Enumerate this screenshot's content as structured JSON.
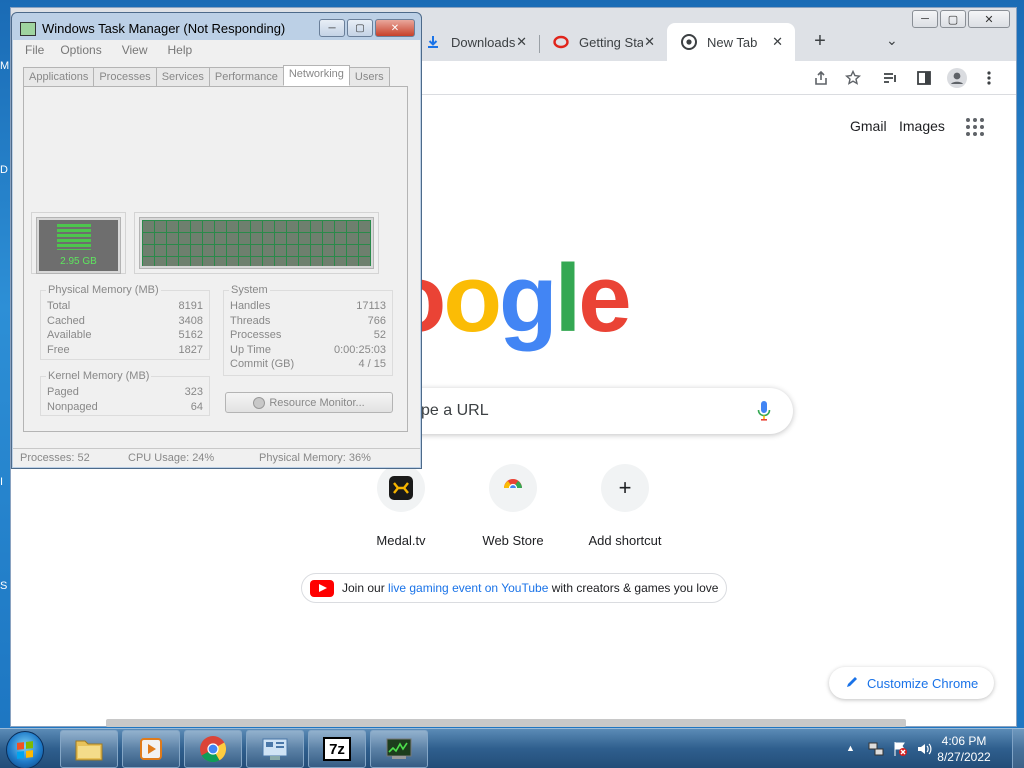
{
  "desktop": {
    "fragments": [
      "M",
      "D",
      "I",
      "S"
    ]
  },
  "chrome": {
    "window_controls": {
      "minimize": "─",
      "maximize": "▢",
      "close": "✕"
    },
    "tabs": [
      {
        "title": "Downloads",
        "icon": "download-icon"
      },
      {
        "title": "Getting Star",
        "icon": "opera-icon"
      },
      {
        "title": "New Tab",
        "icon": "chrome-icon",
        "active": true
      }
    ],
    "tab_close": "✕",
    "new_tab": "+",
    "tab_search": "⌄",
    "toolbar_icons": [
      "share-icon",
      "bookmark-star-icon",
      "media-controls-icon",
      "side-panel-icon",
      "profile-icon",
      "menu-icon"
    ],
    "ntp": {
      "gmail": "Gmail",
      "images": "Images",
      "logo": "Google",
      "logo_colors": [
        "#4285f4",
        "#ea4335",
        "#fbbc05",
        "#4285f4",
        "#34a853",
        "#ea4335"
      ],
      "search_placeholder": "Search Google or type a URL",
      "search_visible": "pe a URL",
      "shortcuts": [
        {
          "label": "Medal.tv",
          "icon": "medal-icon"
        },
        {
          "label": "Web Store",
          "icon": "webstore-icon"
        },
        {
          "label": "Add shortcut",
          "icon": "plus-icon",
          "glyph": "+"
        }
      ],
      "promo": {
        "pre": "Join our ",
        "link": "live gaming event on YouTube",
        "post": " with creators & games you love"
      },
      "customize": "Customize Chrome"
    }
  },
  "taskmgr": {
    "title": "Windows Task Manager (Not Responding)",
    "menu": [
      "File",
      "Options",
      "View",
      "Help"
    ],
    "tabs": [
      "Applications",
      "Processes",
      "Services",
      "Performance",
      "Networking",
      "Users"
    ],
    "active_tab": "Networking",
    "mem_gauge_label": "2.95 GB",
    "physical_memory": {
      "title": "Physical Memory (MB)",
      "rows": [
        {
          "k": "Total",
          "v": "8191"
        },
        {
          "k": "Cached",
          "v": "3408"
        },
        {
          "k": "Available",
          "v": "5162"
        },
        {
          "k": "Free",
          "v": "1827"
        }
      ]
    },
    "kernel_memory": {
      "title": "Kernel Memory (MB)",
      "rows": [
        {
          "k": "Paged",
          "v": "323"
        },
        {
          "k": "Nonpaged",
          "v": "64"
        }
      ]
    },
    "system": {
      "title": "System",
      "rows": [
        {
          "k": "Handles",
          "v": "17113"
        },
        {
          "k": "Threads",
          "v": "766"
        },
        {
          "k": "Processes",
          "v": "52"
        },
        {
          "k": "Up Time",
          "v": "0:00:25:03"
        },
        {
          "k": "Commit (GB)",
          "v": "4 / 15"
        }
      ]
    },
    "resource_monitor": "Resource Monitor...",
    "status": {
      "processes": "Processes: 52",
      "cpu": "CPU Usage: 24%",
      "memory": "Physical Memory: 36%"
    }
  },
  "taskbar": {
    "pinned": [
      "explorer-icon",
      "media-player-icon",
      "chrome-icon",
      "control-panel-icon",
      "7zip-icon",
      "task-manager-icon"
    ],
    "sevenzip_label": "7z",
    "tray_icons": [
      "show-hidden-icons-icon",
      "network-icon",
      "action-center-icon",
      "volume-icon"
    ],
    "tray_up": "▲",
    "time": "4:06 PM",
    "date": "8/27/2022"
  }
}
